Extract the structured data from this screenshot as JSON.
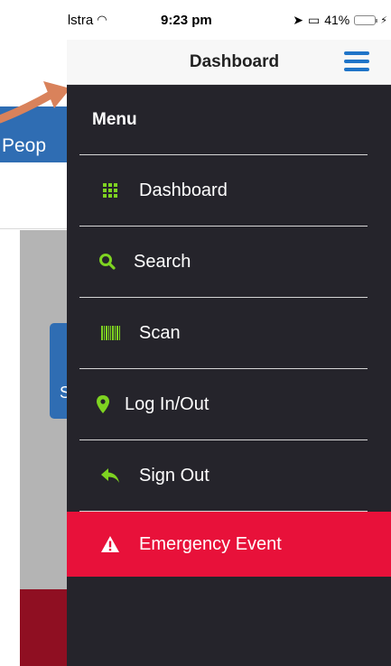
{
  "background": {
    "partial_label": "Peop",
    "partial_tile_letter": "S"
  },
  "status_bar": {
    "carrier": "Telstra",
    "time": "9:23 pm",
    "battery_percent": "41%",
    "battery_level": 0.41
  },
  "nav": {
    "title": "Dashboard",
    "menu_icon": "hamburger-icon"
  },
  "menu": {
    "title": "Menu",
    "items": [
      {
        "label": "Dashboard",
        "icon": "grid-icon"
      },
      {
        "label": "Search",
        "icon": "search-icon"
      },
      {
        "label": "Scan",
        "icon": "barcode-icon"
      },
      {
        "label": "Log In/Out",
        "icon": "map-pin-icon"
      },
      {
        "label": "Sign Out",
        "icon": "reply-arrow-icon"
      },
      {
        "label": "Emergency Event",
        "icon": "warning-icon"
      }
    ]
  },
  "colors": {
    "menu_bg": "#25242b",
    "icon_accent": "#7ed321",
    "emergency": "#e8113a",
    "nav_accent": "#1f74c8"
  }
}
